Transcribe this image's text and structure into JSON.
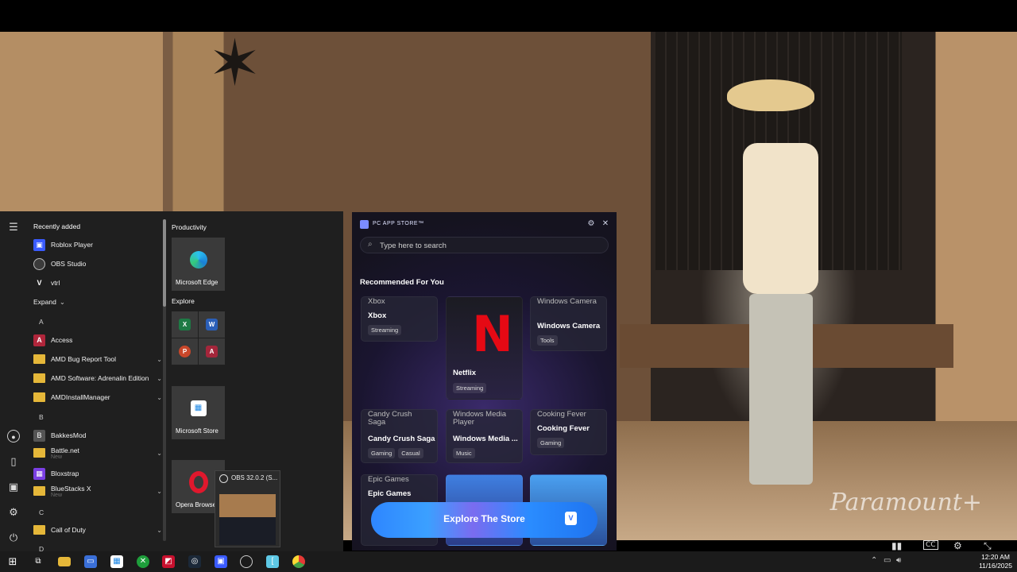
{
  "start_menu": {
    "recently_added_title": "Recently added",
    "recent": [
      {
        "label": "Roblox Player",
        "icon": "roblox-icon",
        "color": "#3a5bff"
      },
      {
        "label": "OBS Studio",
        "icon": "obs-icon",
        "color": "#444444"
      },
      {
        "label": "vtrl",
        "icon": "vtrl-icon",
        "color": "#1f1f1f"
      }
    ],
    "expand_label": "Expand",
    "letter_a": "A",
    "letter_b": "B",
    "letter_c": "C",
    "letter_d": "D",
    "apps": [
      {
        "label": "Access",
        "sub": ""
      },
      {
        "label": "AMD Bug Report Tool",
        "sub": ""
      },
      {
        "label": "AMD Software: Adrenalin Edition",
        "sub": ""
      },
      {
        "label": "AMDInstallManager",
        "sub": ""
      },
      {
        "label": "BakkesMod",
        "sub": ""
      },
      {
        "label": "Battle.net",
        "sub": "New"
      },
      {
        "label": "Bloxstrap",
        "sub": ""
      },
      {
        "label": "BlueStacks X",
        "sub": "New"
      },
      {
        "label": "Call of Duty",
        "sub": ""
      }
    ],
    "tiles": {
      "productivity_title": "Productivity",
      "explore_title": "Explore",
      "edge_label": "Microsoft Edge",
      "store_label": "Microsoft Store",
      "opera_label": "Opera Browser"
    }
  },
  "obs_preview": {
    "title": "OBS 32.0.2 (S..."
  },
  "app_store": {
    "title": "PC APP STORE™",
    "search_placeholder": "Type here to search",
    "recommended_title": "Recommended For You",
    "cards": [
      {
        "name": "Xbox",
        "alt": "Xbox",
        "tags": [
          "Streaming"
        ]
      },
      {
        "name": "Netflix",
        "alt": "",
        "tags": [
          "Streaming"
        ]
      },
      {
        "name": "Windows Camera",
        "alt": "Windows Camera",
        "tags": [
          "Tools"
        ]
      },
      {
        "name": "Candy Crush Saga",
        "alt": "Candy Crush Saga",
        "tags": [
          "Gaming",
          "Casual"
        ]
      },
      {
        "name": "Windows Media ...",
        "alt": "Windows Media Player",
        "tags": [
          "Music"
        ]
      },
      {
        "name": "Cooking Fever",
        "alt": "Cooking Fever",
        "tags": [
          "Gaming"
        ]
      },
      {
        "name": "Epic Games",
        "alt": "Epic Games",
        "tags": []
      }
    ],
    "explore_button": "Explore The Store",
    "accent_color": "#2e86ff"
  },
  "video": {
    "watermark": "Paramount+",
    "cc_label": "CC"
  },
  "taskbar": {
    "time": "12:20 AM",
    "date": "11/16/2025"
  }
}
